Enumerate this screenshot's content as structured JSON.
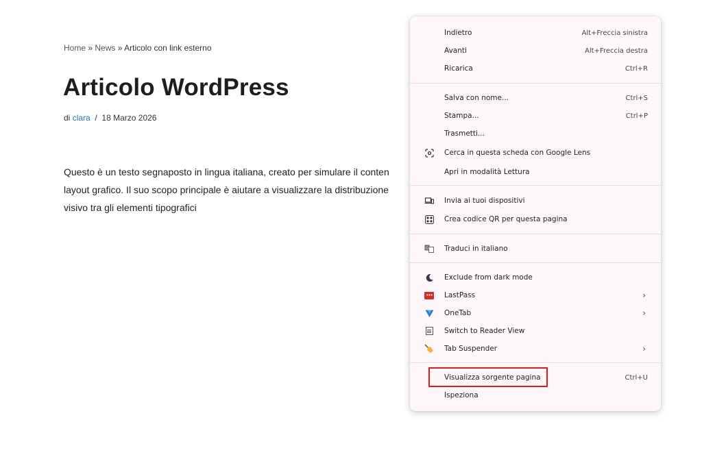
{
  "page": {
    "breadcrumb": {
      "home": "Home",
      "sep1": "»",
      "news": "News",
      "sep2": "»",
      "current": "Articolo con link esterno"
    },
    "title": "Articolo WordPress",
    "meta": {
      "by": "di",
      "author": "clara",
      "sep": "/",
      "date": "18 Marzo 2026"
    },
    "body_lines": [
      "Questo è un testo segnaposto in lingua italiana, creato per simulare il conten",
      "layout grafico. Il suo scopo principale è aiutare a visualizzare la distribuzione",
      "visivo tra gli elementi tipografici"
    ]
  },
  "context_menu": {
    "items": [
      {
        "label": "Indietro",
        "shortcut": "Alt+Freccia sinistra"
      },
      {
        "label": "Avanti",
        "shortcut": "Alt+Freccia destra"
      },
      {
        "label": "Ricarica",
        "shortcut": "Ctrl+R"
      },
      {
        "label": "Salva con nome...",
        "shortcut": "Ctrl+S"
      },
      {
        "label": "Stampa...",
        "shortcut": "Ctrl+P"
      },
      {
        "label": "Trasmetti..."
      },
      {
        "label": "Cerca in questa scheda con Google Lens",
        "icon": "google-lens-icon"
      },
      {
        "label": "Apri in modalità Lettura"
      },
      {
        "label": "Invia ai tuoi dispositivi",
        "icon": "devices-icon"
      },
      {
        "label": "Crea codice QR per questa pagina",
        "icon": "qr-code-icon"
      },
      {
        "label": "Traduci in italiano",
        "icon": "translate-icon"
      },
      {
        "label": "Exclude from dark mode",
        "icon": "moon-icon"
      },
      {
        "label": "LastPass",
        "icon": "lastpass-icon",
        "submenu": true
      },
      {
        "label": "OneTab",
        "icon": "onetab-icon",
        "submenu": true
      },
      {
        "label": "Switch to Reader View",
        "icon": "reader-view-icon"
      },
      {
        "label": "Tab Suspender",
        "icon": "broom-icon",
        "submenu": true
      },
      {
        "label": "Visualizza sorgente pagina",
        "shortcut": "Ctrl+U",
        "highlighted": true
      },
      {
        "label": "Ispeziona"
      }
    ],
    "submenu_arrow": "›",
    "highlight_color": "#e2191a"
  }
}
